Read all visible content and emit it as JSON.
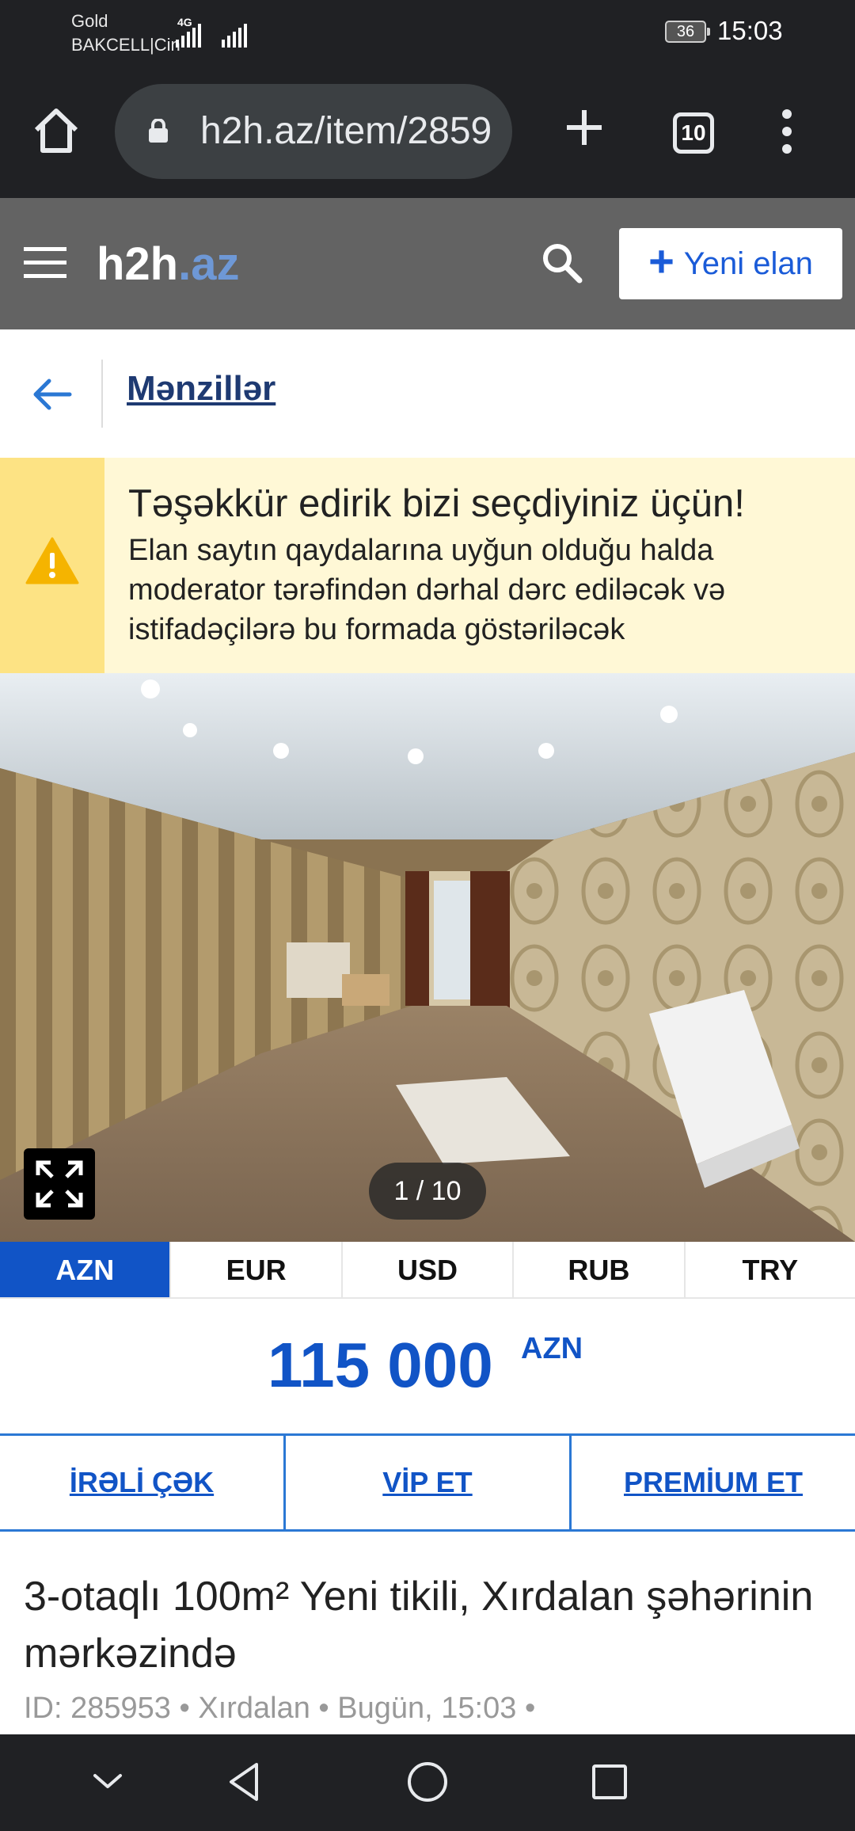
{
  "status_bar": {
    "carrier_line1": "Gold",
    "carrier_line2": "BAKCELL|Cin",
    "network": "4G",
    "battery": "36",
    "time": "15:03"
  },
  "browser": {
    "url": "h2h.az/item/2859",
    "tab_count": "10",
    "icons": [
      "home-icon",
      "lock-icon",
      "plus-icon",
      "tabs-icon",
      "menu-icon"
    ]
  },
  "header": {
    "logo_main": "h2h",
    "logo_suffix": ".az",
    "new_ad_label": "Yeni elan",
    "accent_color": "#1154c6",
    "header_color": "#636363"
  },
  "breadcrumb": {
    "label": "Mənzillər"
  },
  "notice": {
    "title": "Təşəkkür edirik bizi seçdiyiniz üçün!",
    "body": "Elan saytın qaydalarına uyğun olduğu halda moderator tərəfindən dərhal dərc ediləcək və istifadəçilərə bu formada göstəriləcək",
    "bg_color": "#fff8d6",
    "side_color": "#fde384"
  },
  "gallery": {
    "counter": "1 / 10"
  },
  "currency_tabs": [
    "AZN",
    "EUR",
    "USD",
    "RUB",
    "TRY"
  ],
  "active_currency": "AZN",
  "price": {
    "value": "115 000",
    "currency": "AZN"
  },
  "actions": {
    "boost": "İRƏLİ ÇƏK",
    "vip": "VİP ET",
    "premium": "PREMİUM ET"
  },
  "listing": {
    "title": "3-otaqlı 100m² Yeni tikili, Xırdalan şəhərinin mərkəzində",
    "meta": "ID: 285953 • Xırdalan • Bugün, 15:03 •"
  }
}
